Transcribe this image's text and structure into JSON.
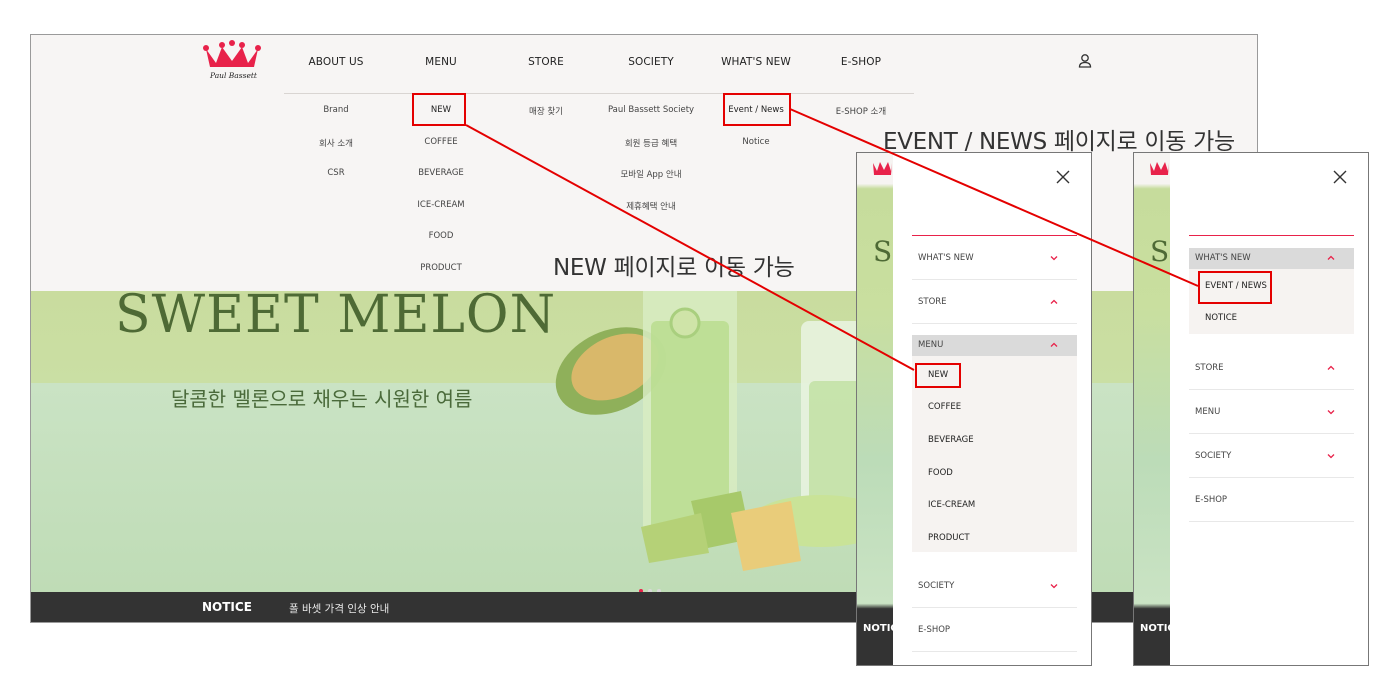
{
  "desktop": {
    "logo_text": "Paul Bassett",
    "gnb": [
      "ABOUT US",
      "MENU",
      "STORE",
      "SOCIETY",
      "WHAT'S NEW",
      "E-SHOP"
    ],
    "submenus": [
      [
        "Brand",
        "회사 소개",
        "CSR"
      ],
      [
        "NEW",
        "COFFEE",
        "BEVERAGE",
        "ICE-CREAM",
        "FOOD",
        "PRODUCT"
      ],
      [
        "매장 찾기"
      ],
      [
        "Paul Bassett Society",
        "회원 등급 혜택",
        "모바일 App 안내",
        "제휴혜택 안내"
      ],
      [
        "Event / News",
        "Notice"
      ],
      [
        "E-SHOP 소개"
      ]
    ],
    "hero_title": "SWEET MELON",
    "hero_subtitle": "달콤한 멜론으로 채우는 시원한 여름",
    "notice_label": "NOTICE",
    "notice_text": "폴 바셋 가격 인상 안내",
    "colors": {
      "accent": "#e8224a",
      "highlight": "#e40000",
      "notice_bar": "#333333"
    }
  },
  "captions": {
    "new_caption": "NEW 페이지로 이동 가능",
    "event_caption": "EVENT / NEWS 페이지로 이동 가능"
  },
  "mobile_menu": {
    "bg_letter": "S",
    "bg_notice": "NOTIC",
    "rows_top": [
      "WHAT'S NEW",
      "STORE"
    ],
    "open_section": "MENU",
    "open_items": [
      "NEW",
      "COFFEE",
      "BEVERAGE",
      "FOOD",
      "ICE-CREAM",
      "PRODUCT"
    ],
    "rows_bottom": [
      "SOCIETY",
      "E-SHOP"
    ]
  },
  "mobile_whatsnew": {
    "bg_letter": "S",
    "bg_notice": "NOTIC",
    "open_section": "WHAT'S NEW",
    "open_items": [
      "EVENT / NEWS",
      "NOTICE"
    ],
    "rows_bottom": [
      "STORE",
      "MENU",
      "SOCIETY",
      "E-SHOP"
    ]
  }
}
